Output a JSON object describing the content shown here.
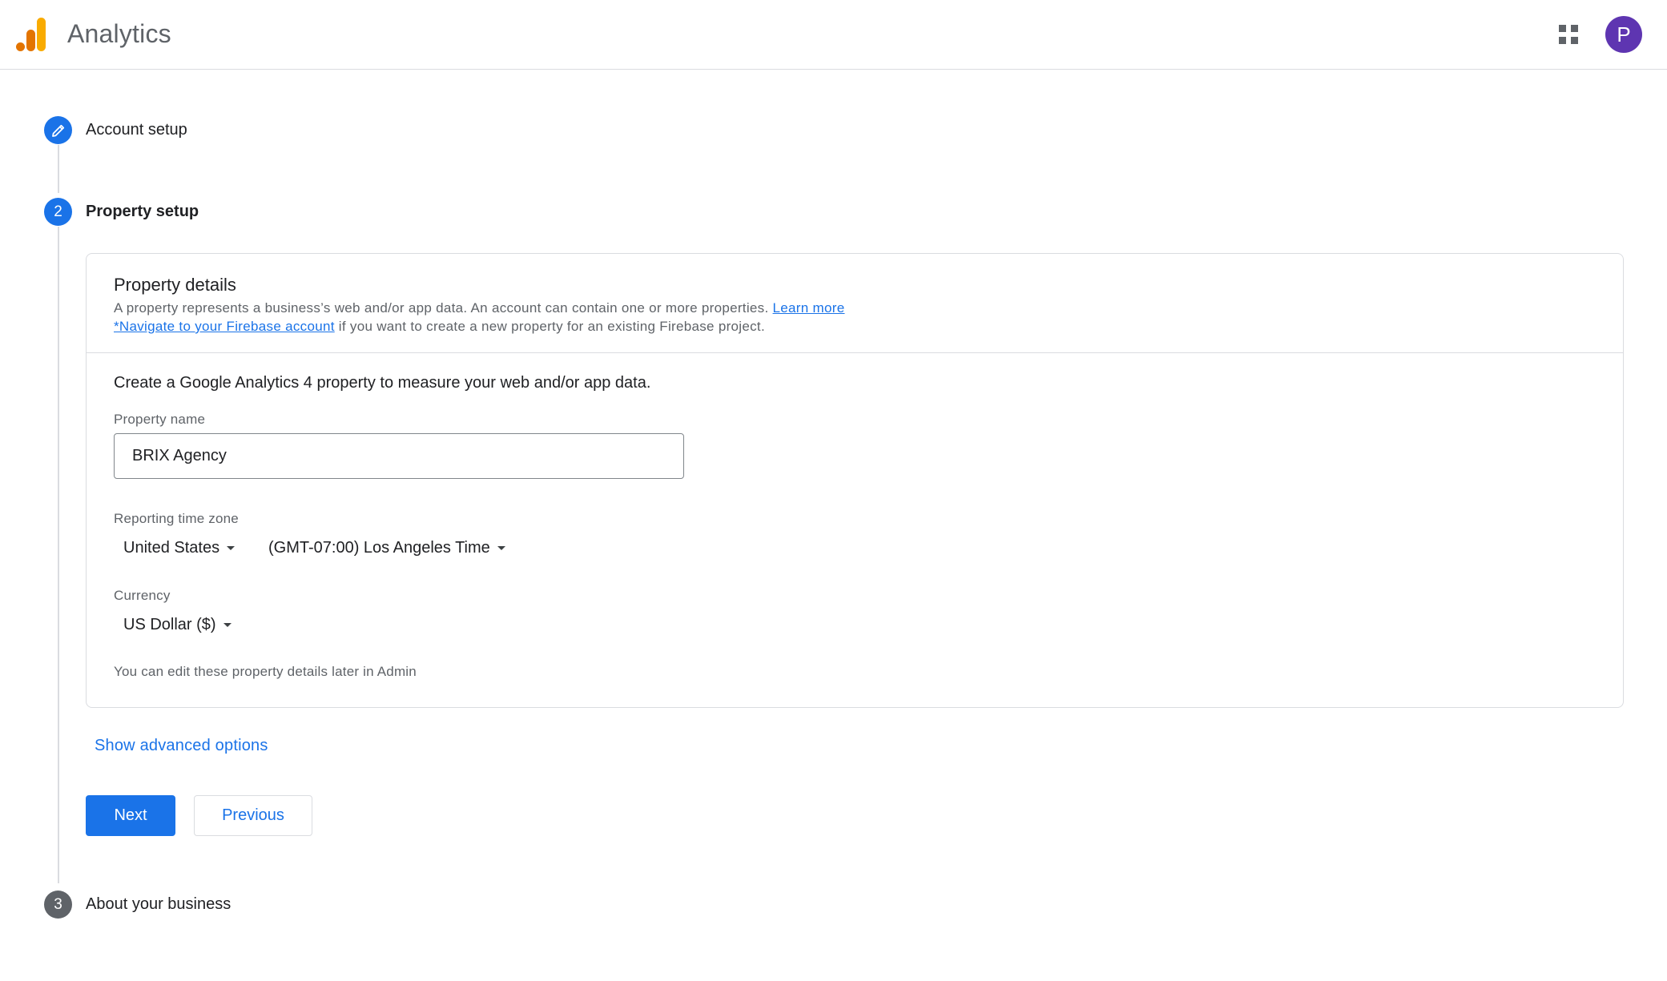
{
  "header": {
    "app_title": "Analytics",
    "logo_icon": "analytics-bars-icon",
    "apps_icon": "apps-grid-icon",
    "avatar_initial": "P",
    "colors": {
      "logo_orange": "#f9ab00",
      "logo_dark_orange": "#e37400",
      "avatar": "#5e35b1"
    }
  },
  "stepper": {
    "steps": [
      {
        "label": "Account setup",
        "icon": "pencil-edit-icon",
        "state": "completed"
      },
      {
        "label": "Property setup",
        "number": "2",
        "state": "active"
      },
      {
        "label": "About your business",
        "number": "3",
        "state": "pending"
      }
    ]
  },
  "property_details": {
    "title": "Property details",
    "description": "A property represents a business’s web and/or app data. An account can contain one or more properties.",
    "learn_more": "Learn more",
    "firebase_link": "*Navigate to your Firebase account",
    "firebase_suffix": "if you want to create a new property for an existing Firebase project.",
    "intro": "Create a Google Analytics 4 property to measure your web and/or app data.",
    "property_name_label": "Property name",
    "property_name_value": "BRIX Agency",
    "timezone_label": "Reporting time zone",
    "country_value": "United States",
    "timezone_value": "(GMT-07:00) Los Angeles Time",
    "currency_label": "Currency",
    "currency_value": "US Dollar ($)",
    "note": "You can edit these property details later in Admin"
  },
  "actions": {
    "advanced": "Show advanced options",
    "next": "Next",
    "previous": "Previous"
  },
  "colors": {
    "primary": "#1a73e8",
    "step_pending": "#5f6368",
    "border": "#dadce0"
  }
}
